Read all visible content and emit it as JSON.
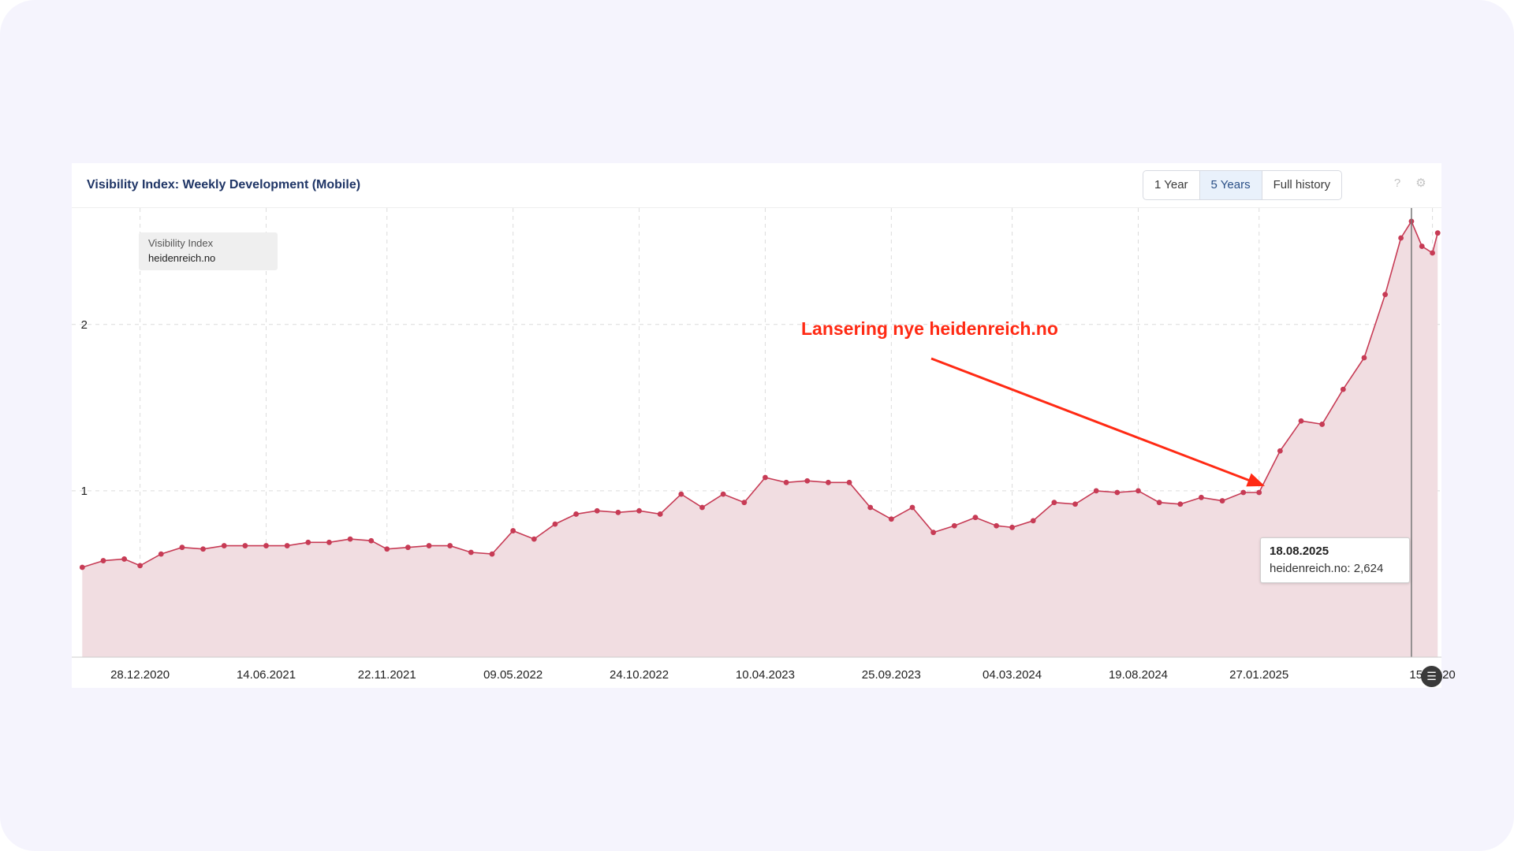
{
  "chart_title": "Visibility Index: Weekly Development (Mobile)",
  "range_buttons": {
    "one_year": "1 Year",
    "five_years": "5 Years",
    "full_history": "Full history",
    "active": "5 Years"
  },
  "header_icons": {
    "help": "help-icon",
    "settings": "gear-icon"
  },
  "legend": {
    "title": "Visibility Index",
    "series": "heidenreich.no"
  },
  "tooltip": {
    "date": "18.08.2025",
    "value": "heidenreich.no: 2,624"
  },
  "annotation": {
    "text": "Lansering nye heidenreich.no"
  },
  "colors": {
    "series_line": "#c73b55",
    "series_fill": "#f1dde1",
    "annotation": "#ff2a14",
    "title": "#1f3566"
  },
  "chart_data": {
    "type": "area",
    "title": "Visibility Index: Weekly Development (Mobile)",
    "xlabel": "",
    "ylabel": "",
    "x_tick_labels": [
      "28.12.2020",
      "14.06.2021",
      "22.11.2021",
      "09.05.2022",
      "24.10.2022",
      "10.04.2023",
      "25.09.2023",
      "04.03.2024",
      "19.08.2024",
      "27.01.2025",
      "15.09.20"
    ],
    "y_ticks": [
      1,
      2
    ],
    "ylim": [
      0,
      2.7
    ],
    "grid": true,
    "legend_position": "top-left",
    "series": [
      {
        "name": "heidenreich.no",
        "x": [
          "2020-10-12",
          "2020-11-09",
          "2020-12-07",
          "2020-12-28",
          "2021-01-25",
          "2021-02-22",
          "2021-03-22",
          "2021-04-19",
          "2021-05-17",
          "2021-06-14",
          "2021-07-12",
          "2021-08-09",
          "2021-09-06",
          "2021-10-04",
          "2021-11-01",
          "2021-11-22",
          "2021-12-20",
          "2022-01-17",
          "2022-02-14",
          "2022-03-14",
          "2022-04-11",
          "2022-05-09",
          "2022-06-06",
          "2022-07-04",
          "2022-08-01",
          "2022-08-29",
          "2022-09-26",
          "2022-10-24",
          "2022-11-21",
          "2022-12-19",
          "2023-01-16",
          "2023-02-13",
          "2023-03-13",
          "2023-04-10",
          "2023-05-08",
          "2023-06-05",
          "2023-07-03",
          "2023-07-31",
          "2023-08-28",
          "2023-09-25",
          "2023-10-23",
          "2023-11-20",
          "2023-12-18",
          "2024-01-15",
          "2024-02-12",
          "2024-03-04",
          "2024-04-01",
          "2024-04-29",
          "2024-05-27",
          "2024-06-24",
          "2024-07-22",
          "2024-08-19",
          "2024-09-16",
          "2024-10-14",
          "2024-11-11",
          "2024-12-09",
          "2025-01-06",
          "2025-01-27",
          "2025-02-24",
          "2025-03-24",
          "2025-04-21",
          "2025-05-19",
          "2025-06-16",
          "2025-07-14",
          "2025-08-04",
          "2025-08-18",
          "2025-09-01",
          "2025-09-15",
          "2025-09-22"
        ],
        "y": [
          0.54,
          0.58,
          0.59,
          0.55,
          0.62,
          0.66,
          0.65,
          0.67,
          0.67,
          0.67,
          0.67,
          0.69,
          0.69,
          0.71,
          0.7,
          0.65,
          0.66,
          0.67,
          0.67,
          0.63,
          0.62,
          0.76,
          0.71,
          0.8,
          0.86,
          0.88,
          0.87,
          0.88,
          0.86,
          0.98,
          0.9,
          0.98,
          0.93,
          1.08,
          1.05,
          1.06,
          1.05,
          1.05,
          0.9,
          0.83,
          0.9,
          0.75,
          0.79,
          0.84,
          0.79,
          0.78,
          0.82,
          0.93,
          0.92,
          1.0,
          0.99,
          1.0,
          0.93,
          0.92,
          0.96,
          0.94,
          0.99,
          0.99,
          1.24,
          1.42,
          1.4,
          1.61,
          1.8,
          2.18,
          2.52,
          2.62,
          2.47,
          2.43,
          2.55
        ]
      }
    ]
  }
}
